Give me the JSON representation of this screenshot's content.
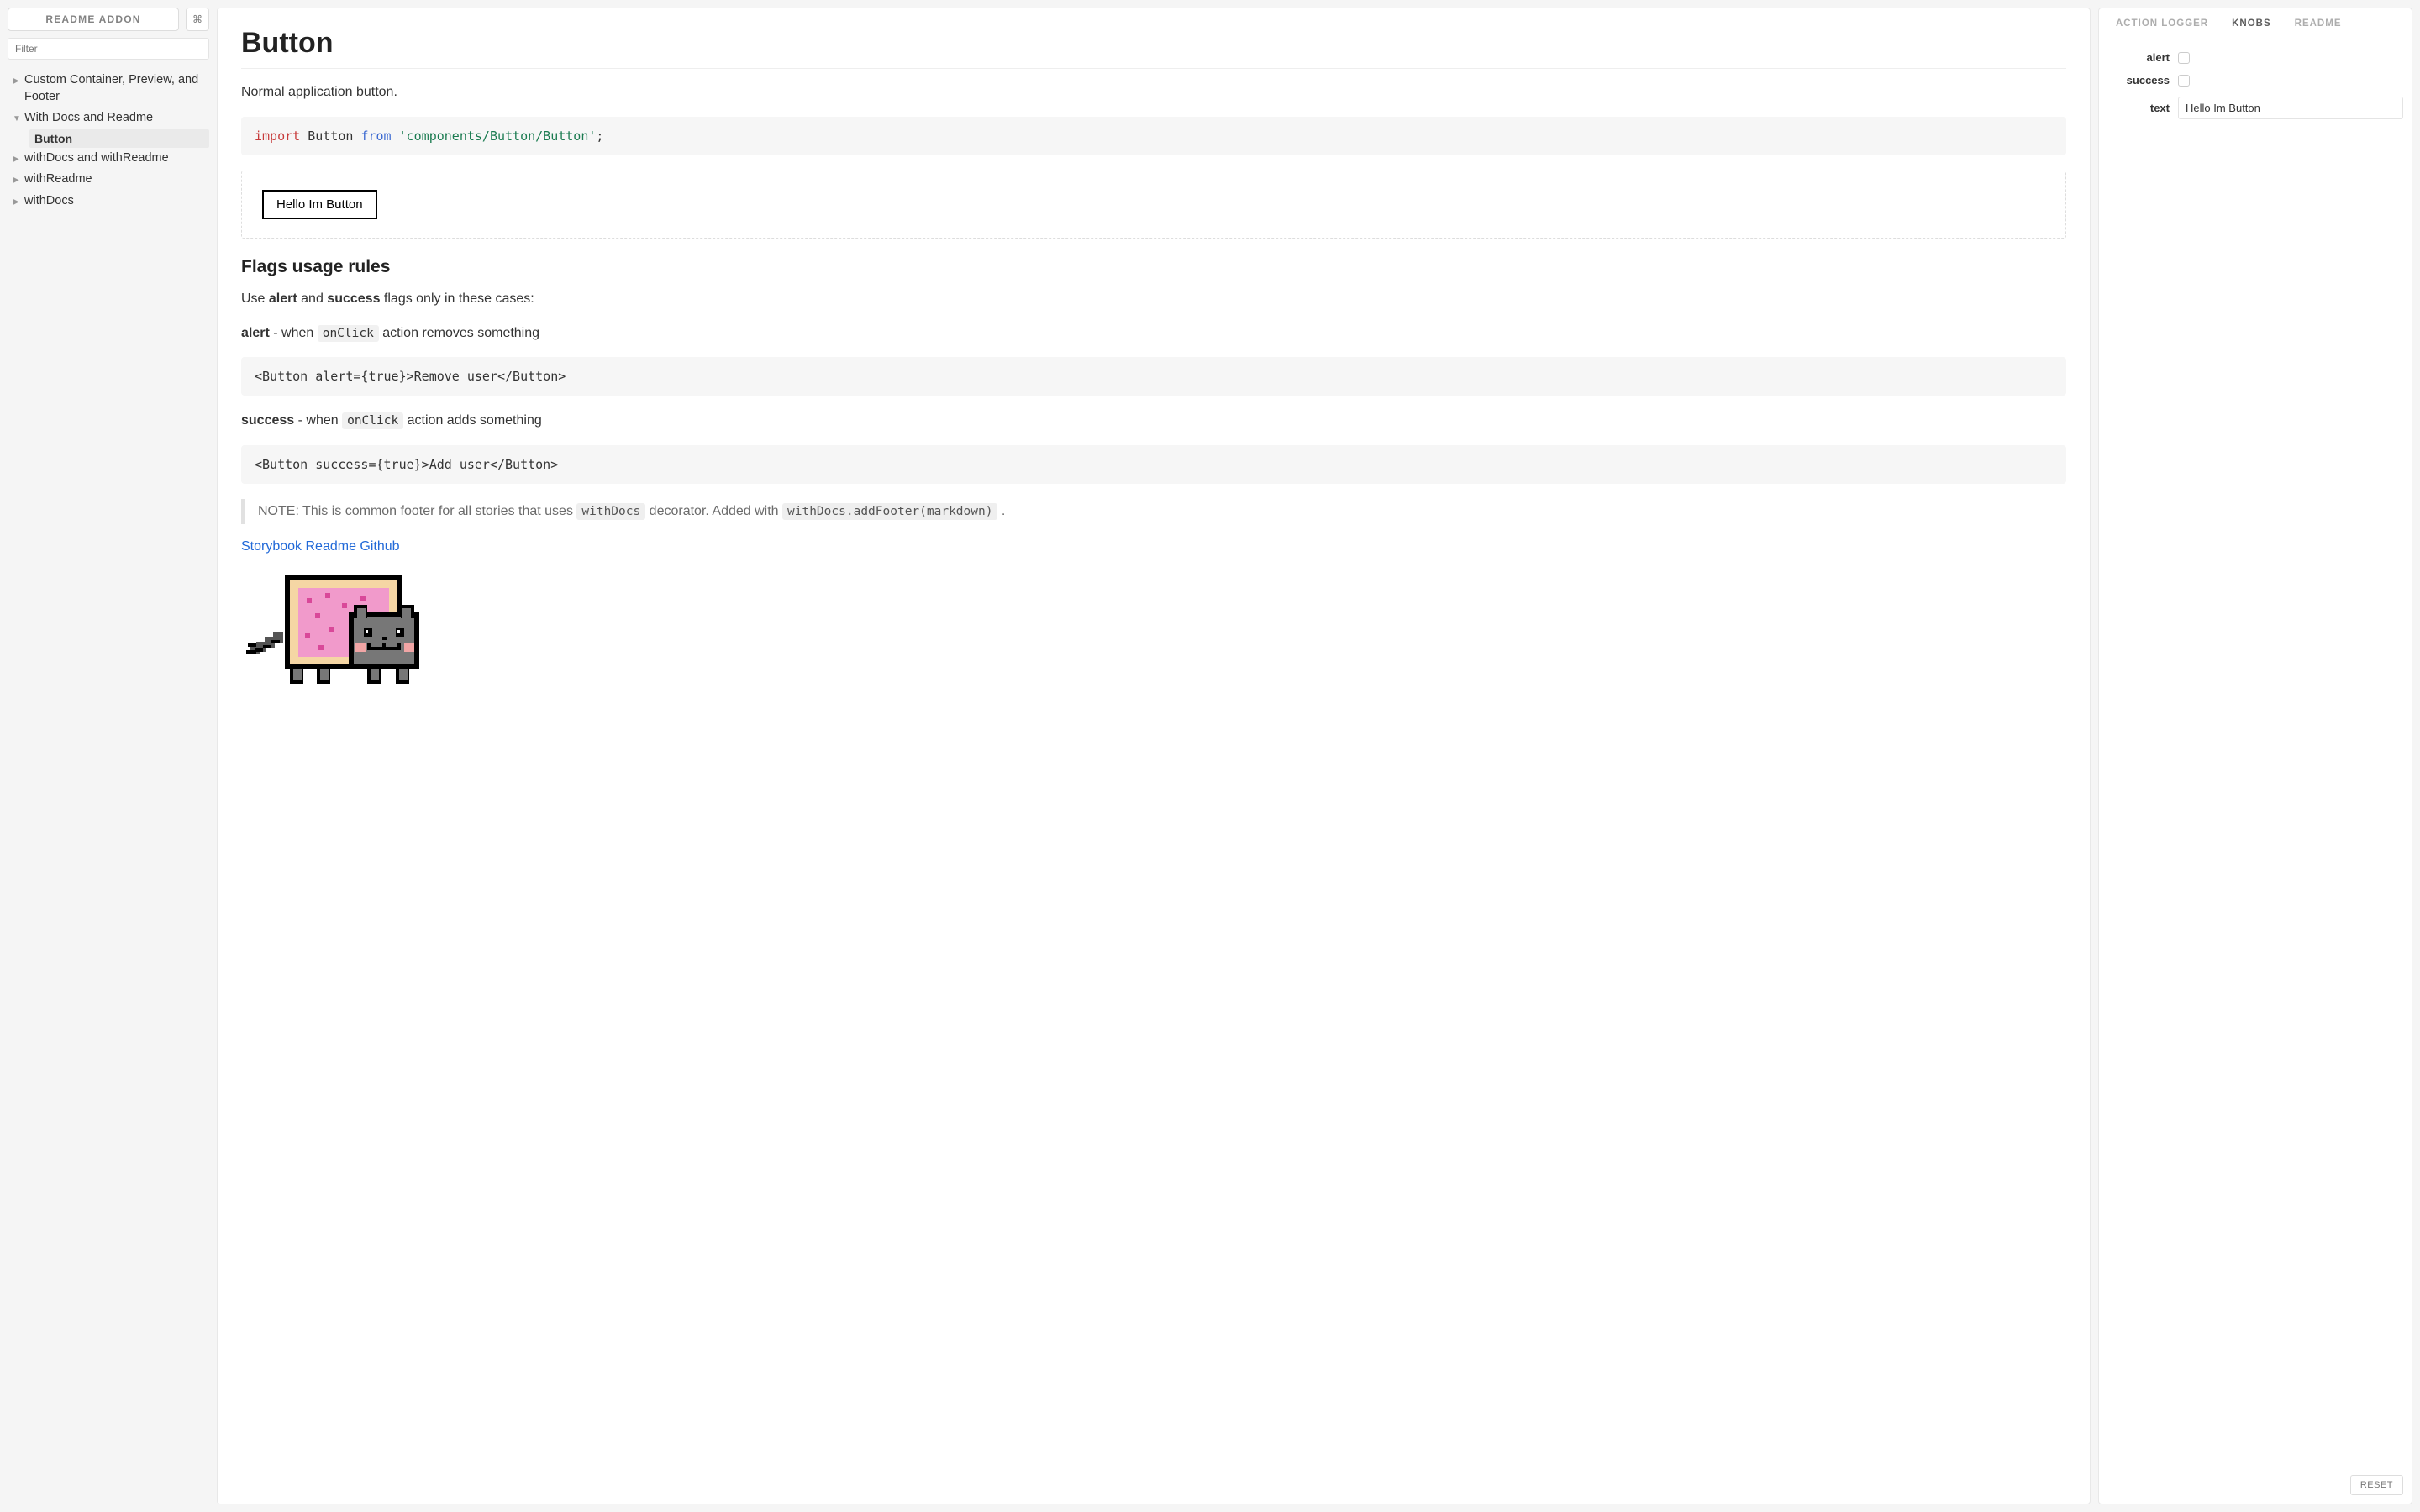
{
  "sidebar": {
    "brand": "README ADDON",
    "shortcut_glyph": "⌘",
    "filter_placeholder": "Filter",
    "tree": [
      {
        "label": "Custom Container, Preview, and Footer",
        "expanded": false,
        "children": []
      },
      {
        "label": "With Docs and Readme",
        "expanded": true,
        "children": [
          {
            "label": "Button",
            "selected": true
          }
        ]
      },
      {
        "label": "withDocs and withReadme",
        "expanded": false,
        "children": []
      },
      {
        "label": "withReadme",
        "expanded": false,
        "children": []
      },
      {
        "label": "withDocs",
        "expanded": false,
        "children": []
      }
    ]
  },
  "doc": {
    "title": "Button",
    "subtitle": "Normal application button.",
    "code_import": {
      "kw": "import",
      "name": "Button",
      "from": "from",
      "path": "'components/Button/Button'",
      "semi": ";"
    },
    "preview_button_text": "Hello Im Button",
    "flags_heading": "Flags usage rules",
    "flags_intro_pre": "Use ",
    "flags_intro_b1": "alert",
    "flags_intro_mid": " and ",
    "flags_intro_b2": "success",
    "flags_intro_post": " flags only in these cases:",
    "alert_b": "alert",
    "alert_mid": " - when ",
    "alert_code": "onClick",
    "alert_post": " action removes something",
    "code_alert": "<Button alert={true}>Remove user</Button>",
    "success_b": "success",
    "success_mid": " - when ",
    "success_code": "onClick",
    "success_post": " action adds something",
    "code_success": "<Button success={true}>Add user</Button>",
    "note_pre": "NOTE: This is common footer for all stories that uses ",
    "note_code1": "withDocs",
    "note_mid": " decorator. Added with ",
    "note_code2": "withDocs.addFooter(markdown)",
    "note_post": " .",
    "link_text": "Storybook Readme Github"
  },
  "right": {
    "tabs": [
      {
        "label": "ACTION LOGGER",
        "active": false
      },
      {
        "label": "KNOBS",
        "active": true
      },
      {
        "label": "README",
        "active": false
      }
    ],
    "knobs": {
      "alert_label": "alert",
      "success_label": "success",
      "text_label": "text",
      "text_value": "Hello Im Button"
    },
    "reset_label": "RESET"
  }
}
